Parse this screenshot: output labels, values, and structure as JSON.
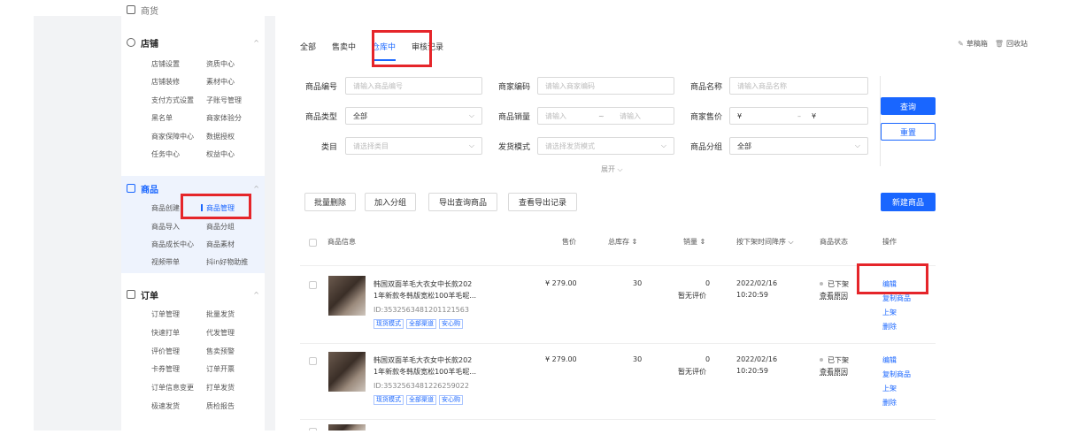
{
  "sidebar": {
    "top_partial": "商货",
    "store": {
      "title": "店铺",
      "items": [
        "店铺设置",
        "资质中心",
        "店铺装修",
        "素材中心",
        "支付方式设置",
        "子账号管理",
        "黑名单",
        "商家体验分",
        "商家保障中心",
        "数据授权",
        "任务中心",
        "权益中心"
      ]
    },
    "goods": {
      "title": "商品",
      "items": [
        "商品创建",
        "商品管理",
        "商品导入",
        "商品分组",
        "商品成长中心",
        "商品素材",
        "视频带单",
        "抖in好物助推"
      ]
    },
    "orders": {
      "title": "订单",
      "items": [
        "订单管理",
        "批量发货",
        "快速打单",
        "代发管理",
        "评价管理",
        "售卖预警",
        "卡券管理",
        "订单开票",
        "订单信息变更",
        "打单发货",
        "极速发货",
        "质检报告"
      ]
    }
  },
  "tabs": [
    "全部",
    "售卖中",
    "仓库中",
    "审核记录"
  ],
  "tabs_right": {
    "draft": "草稿箱",
    "recycle": "回收站"
  },
  "filters": {
    "product_no": {
      "label": "商品编号",
      "placeholder": "请输入商品编号"
    },
    "merchant_code": {
      "label": "商家编码",
      "placeholder": "请输入商家编码"
    },
    "product_name": {
      "label": "商品名称",
      "placeholder": "请输入商品名称"
    },
    "product_type": {
      "label": "商品类型",
      "value": "全部"
    },
    "sales": {
      "label": "商品销量",
      "from": "请输入",
      "to": "请输入",
      "sep": "~"
    },
    "price": {
      "label": "商家售价",
      "from": "¥",
      "to": "¥",
      "sep": "–"
    },
    "category": {
      "label": "类目",
      "placeholder": "请选择类目"
    },
    "ship_mode": {
      "label": "发货模式",
      "placeholder": "请选择发货模式"
    },
    "group": {
      "label": "商品分组",
      "value": "全部"
    },
    "query_btn": "查询",
    "reset_btn": "重置",
    "expand": "展开"
  },
  "actions": {
    "batch_delete": "批量删除",
    "add_group": "加入分组",
    "export_query": "导出查询商品",
    "export_record": "查看导出记录",
    "new_product": "新建商品"
  },
  "table": {
    "headers": {
      "info": "商品信息",
      "price": "售价",
      "stock": "总库存 ⇕",
      "sales": "销量 ⇕",
      "time": "按下架时间降序 ⌵",
      "status": "商品状态",
      "ops": "操作"
    },
    "rows": [
      {
        "name_line1": "韩国双面羊毛大衣女中长款202",
        "name_line2": "1年新款冬韩版宽松100羊毛呢...",
        "id": "ID:3532563481201121563",
        "tags": [
          "现货模式",
          "全部渠道",
          "安心购"
        ],
        "price": "¥ 279.00",
        "stock": "30",
        "sales": "0",
        "rating": "暂无评价",
        "date": "2022/02/16",
        "time": "10:20:59",
        "status": "已下架",
        "reason": "查看原因",
        "ops": [
          "编辑",
          "复制商品",
          "上架",
          "删除"
        ]
      },
      {
        "name_line1": "韩国双面羊毛大衣女中长款202",
        "name_line2": "1年新款冬韩版宽松100羊毛呢...",
        "id": "ID:3532563481226259022",
        "tags": [
          "现货模式",
          "全部渠道",
          "安心购"
        ],
        "price": "¥ 279.00",
        "stock": "30",
        "sales": "0",
        "rating": "暂无评价",
        "date": "2022/02/16",
        "time": "10:20:59",
        "status": "已下架",
        "reason": "查看原因",
        "ops": [
          "编辑",
          "复制商品",
          "上架",
          "删除"
        ]
      }
    ]
  },
  "colors": {
    "accent": "#1966ff",
    "highlight": "#e5252a"
  }
}
